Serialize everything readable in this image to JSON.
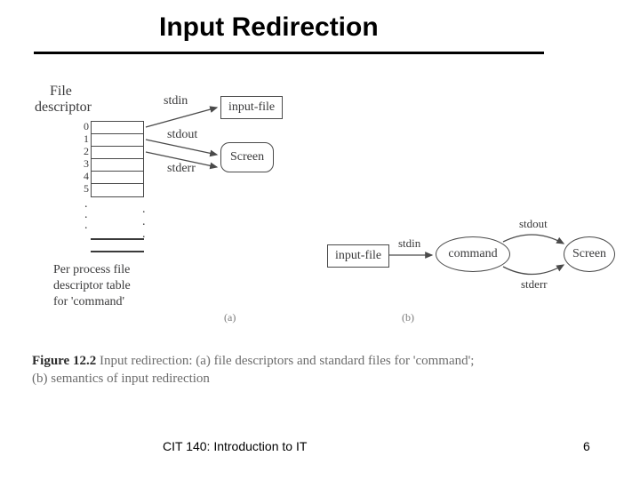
{
  "header": {
    "title": "Input Redirection"
  },
  "diagram_a": {
    "fd_label_top": "File",
    "fd_label_bottom": "descriptor",
    "numbers": [
      "0",
      "1",
      "2",
      "3",
      "4",
      "5"
    ],
    "arrows": {
      "stdin": "stdin",
      "stdout": "stdout",
      "stderr": "stderr"
    },
    "nodes": {
      "input_file": "input-file",
      "screen": "Screen"
    },
    "caption1": "Per process file",
    "caption2": "descriptor table",
    "caption3": "for 'command'",
    "sublabel": "(a)"
  },
  "diagram_b": {
    "nodes": {
      "input_file": "input-file",
      "command": "command",
      "screen": "Screen"
    },
    "arrows": {
      "stdin": "stdin",
      "stdout": "stdout",
      "stderr": "stderr"
    },
    "sublabel": "(b)"
  },
  "figure": {
    "bold": "Figure 12.2",
    "text1": " Input redirection: (a) file descriptors and standard files for 'command';",
    "text2": "(b) semantics of input redirection"
  },
  "footer": {
    "course": "CIT 140: Introduction to IT",
    "page": "6"
  }
}
